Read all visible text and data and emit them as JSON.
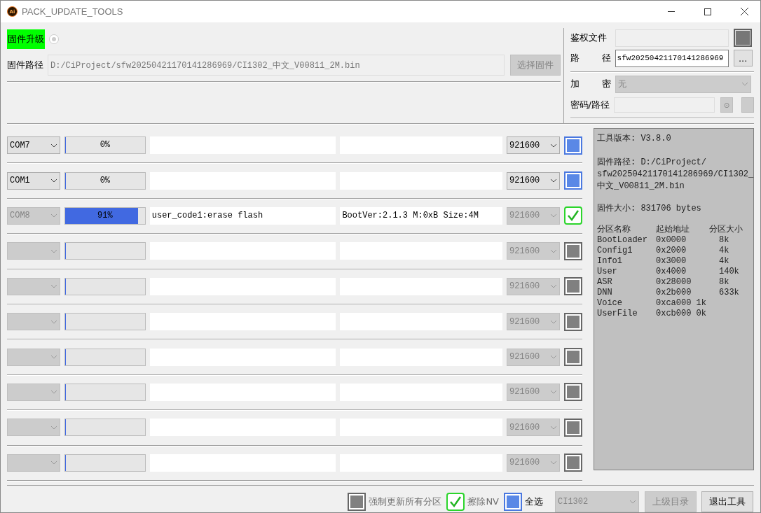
{
  "window": {
    "title": "PACK_UPDATE_TOOLS",
    "icon_label": "Ai"
  },
  "upgrade": {
    "label": "固件升级",
    "radio_selected": false
  },
  "firmware": {
    "label": "固件路径",
    "value": "D:/CiProject/sfw20250421170141286969/CI1302_中文_V00811_2M.bin",
    "button": "选择固件",
    "button_disabled": true
  },
  "auth": {
    "file_label": "鉴权文件",
    "path_label_1": "路",
    "path_label_2": "径",
    "path_value": "sfw20250421170141286969",
    "browse_button": "...",
    "encrypt_label_1": "加",
    "encrypt_label_2": "密",
    "encrypt_value": "无",
    "password_label": "密码/路径",
    "radio_button": "⊙",
    "radio_selected": false
  },
  "ports": [
    {
      "port": "COM7",
      "disabled": false,
      "progress": "0%",
      "level": 0,
      "baud": "921600",
      "kind": "selected"
    },
    {
      "port": "COM1",
      "disabled": false,
      "progress": "0%",
      "level": 0,
      "baud": "921600",
      "kind": "selected"
    },
    {
      "port": "COM8",
      "disabled": true,
      "progress": "91%",
      "level": 0.91,
      "status": "user_code1:erase flash",
      "info": "BootVer:2.1.3 M:0xB Size:4M",
      "baud": "921600",
      "kind": "done"
    },
    {
      "disabled": true,
      "level": 0,
      "baud": "921600",
      "kind": "off"
    },
    {
      "disabled": true,
      "level": 0,
      "baud": "921600",
      "kind": "off"
    },
    {
      "disabled": true,
      "level": 0,
      "baud": "921600",
      "kind": "off"
    },
    {
      "disabled": true,
      "level": 0,
      "baud": "921600",
      "kind": "off"
    },
    {
      "disabled": true,
      "level": 0,
      "baud": "921600",
      "kind": "off"
    },
    {
      "disabled": true,
      "level": 0,
      "baud": "921600",
      "kind": "off"
    },
    {
      "disabled": true,
      "level": 0,
      "baud": "921600",
      "kind": "off"
    }
  ],
  "info_panel": {
    "version_label": "工具版本:",
    "version": "V3.8.0",
    "path_label": "固件路径:",
    "path_lines": [
      "D:/CiProject/",
      "sfw20250421170141286969/CI1302_",
      "中文_V00811_2M.bin"
    ],
    "size_label": "固件大小:",
    "size": "831706 bytes",
    "partition_columns": [
      "分区名称",
      "起始地址",
      "分区大小"
    ],
    "partitions": [
      {
        "name": "BootLoader",
        "address": "0x0000",
        "size": "8k"
      },
      {
        "name": "Config1",
        "address": "0x2000",
        "size": "4k"
      },
      {
        "name": "Info1",
        "address": "0x3000",
        "size": "4k"
      },
      {
        "name": "User",
        "address": "0x4000",
        "size": "140k"
      },
      {
        "name": "ASR",
        "address": "0x28000",
        "size": "8k"
      },
      {
        "name": "DNN",
        "address": "0x2b000",
        "size": "633k"
      },
      {
        "name": "Voice",
        "address": "0xca000 1k"
      },
      {
        "name": "UserFile",
        "address": "0xcb000 0k"
      }
    ]
  },
  "footer": {
    "options": [
      {
        "label": "强制更新所有分区",
        "kind": "off",
        "disabled": true
      },
      {
        "label": "擦除NV",
        "kind": "done",
        "disabled": true
      },
      {
        "label": "全选",
        "kind": "selected",
        "disabled": false
      }
    ],
    "chip": "CI1302",
    "parent_button": "上级目录",
    "exit_button": "退出工具"
  }
}
